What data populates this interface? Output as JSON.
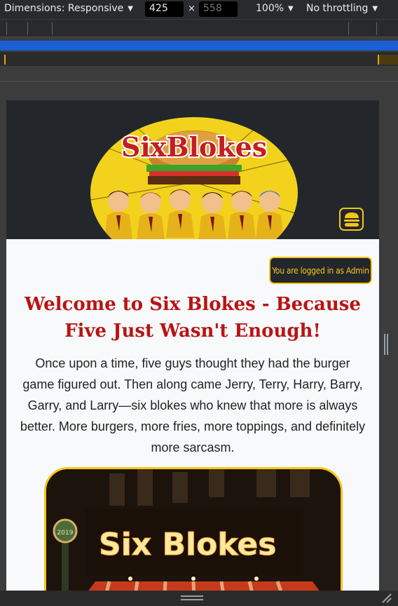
{
  "devtools": {
    "dimensions_label": "Dimensions: Responsive",
    "width_value": "425",
    "height_value": "558",
    "times_symbol": "×",
    "zoom_label": "100%",
    "throttling_label": "No throttling",
    "caret_icon": "chevron-down-icon"
  },
  "site": {
    "logo_text": "SixBlokes",
    "menu_icon": "burger-menu-icon",
    "login_badge": "You are logged in as Admin",
    "title": "Welcome to Six Blokes - Because Five Just Wasn't Enough!",
    "intro": "Once upon a time, five guys thought they had the burger game figured out. Then along came Jerry, Terry, Harry, Barry, Garry, and Larry—six blokes who knew that more is always better. More burgers, more fries, more toppings, and definitely more sarcasm.",
    "storefront_sign": "Six Blokes",
    "storefront_clock": "2019"
  },
  "colors": {
    "brand_yellow": "#f5c518",
    "brand_red": "#b81414",
    "header_dark": "#23272b",
    "devtools_blue": "#1a5fd6"
  }
}
